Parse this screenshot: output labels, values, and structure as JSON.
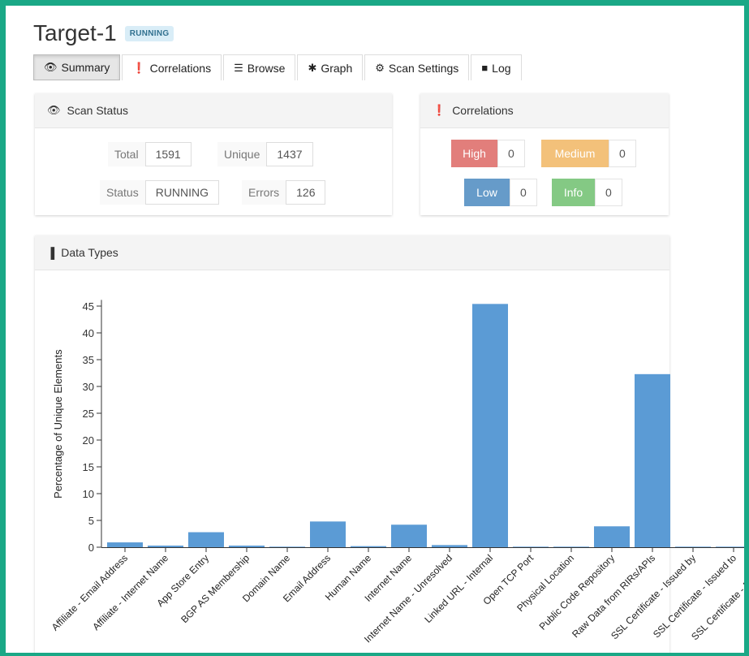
{
  "header": {
    "title": "Target-1",
    "status_badge": "RUNNING"
  },
  "tabs": [
    {
      "label": "Summary",
      "icon": "eye-icon"
    },
    {
      "label": "Correlations",
      "icon": "exclamation-circle-icon"
    },
    {
      "label": "Browse",
      "icon": "list-icon"
    },
    {
      "label": "Graph",
      "icon": "asterisk-icon"
    },
    {
      "label": "Scan Settings",
      "icon": "gear-icon"
    },
    {
      "label": "Log",
      "icon": "book-icon"
    }
  ],
  "scan_status": {
    "title": "Scan Status",
    "total_label": "Total",
    "total_value": "1591",
    "unique_label": "Unique",
    "unique_value": "1437",
    "status_label": "Status",
    "status_value": "RUNNING",
    "errors_label": "Errors",
    "errors_value": "126"
  },
  "correlations": {
    "title": "Correlations",
    "high_label": "High",
    "high_value": "0",
    "medium_label": "Medium",
    "medium_value": "0",
    "low_label": "Low",
    "low_value": "0",
    "info_label": "Info",
    "info_value": "0",
    "colors": {
      "high": "#d9534f",
      "medium": "#f0ad4e",
      "low": "#337ab7",
      "info": "#5cb85c"
    }
  },
  "data_types": {
    "title": "Data Types"
  },
  "chart_data": {
    "type": "bar",
    "ylabel": "Percentage of Unique Elements",
    "ylim": [
      0,
      46
    ],
    "yticks": [
      0,
      5,
      10,
      15,
      20,
      25,
      30,
      35,
      40,
      45
    ],
    "bar_color": "#5b9bd5",
    "categories": [
      "Affiliate - Email Address",
      "Affiliate - Internet Name",
      "App Store Entry",
      "BGP AS Membership",
      "Domain Name",
      "Email Address",
      "Human Name",
      "Internet Name",
      "Internet Name - Unresolved",
      "Linked URL - Internal",
      "Open TCP Port",
      "Physical Location",
      "Public Code Repository",
      "Raw Data from RIRs/APIs",
      "SSL Certificate - Issued by",
      "SSL Certificate - Issued to",
      "SSL Certificate - Raw Data"
    ],
    "values": [
      0.9,
      0.3,
      2.8,
      0.3,
      0.1,
      4.8,
      0.2,
      4.2,
      0.4,
      45.4,
      0.1,
      0.1,
      3.9,
      32.3,
      0.1,
      0.1,
      0.1
    ]
  }
}
